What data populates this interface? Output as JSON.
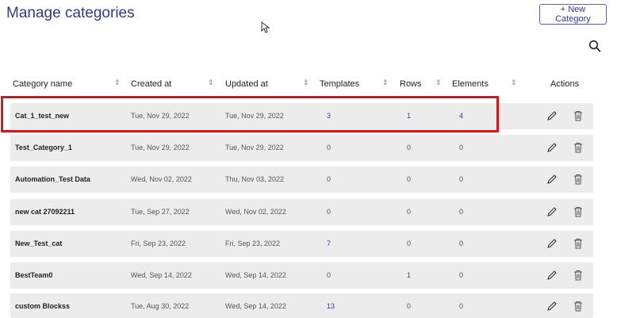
{
  "page": {
    "title": "Manage categories",
    "new_button": "+ New Category"
  },
  "table": {
    "headers": [
      "Category name",
      "Created at",
      "Updated at",
      "Templates",
      "Rows",
      "Elements",
      "Actions"
    ],
    "rows": [
      {
        "name": "Cat_1_test_new",
        "created": "Tue, Nov 29, 2022",
        "updated": "Tue, Nov 29, 2022",
        "templates": "3",
        "rows": "1",
        "elements": "4"
      },
      {
        "name": "Test_Category_1",
        "created": "Tue, Nov 29, 2022",
        "updated": "Tue, Nov 29, 2022",
        "templates": "0",
        "rows": "0",
        "elements": "0"
      },
      {
        "name": "Automation_Test Data",
        "created": "Wed, Nov 02, 2022",
        "updated": "Thu, Nov 03, 2022",
        "templates": "0",
        "rows": "0",
        "elements": "0"
      },
      {
        "name": "new cat 27092211",
        "created": "Tue, Sep 27, 2022",
        "updated": "Wed, Nov 02, 2022",
        "templates": "0",
        "rows": "0",
        "elements": "0"
      },
      {
        "name": "New_Test_cat",
        "created": "Fri, Sep 23, 2022",
        "updated": "Fri, Sep 23, 2022",
        "templates": "7",
        "rows": "0",
        "elements": "0"
      },
      {
        "name": "BestTeam0",
        "created": "Wed, Sep 14, 2022",
        "updated": "Wed, Sep 14, 2022",
        "templates": "0",
        "rows": "1",
        "elements": "0"
      },
      {
        "name": "custom Blockss",
        "created": "Tue, Aug 30, 2022",
        "updated": "Wed, Sep 14, 2022",
        "templates": "13",
        "rows": "0",
        "elements": "0"
      }
    ]
  },
  "icons": {
    "search": "search-icon",
    "edit": "pencil-icon",
    "delete": "trash-icon",
    "sort": "sort-icon",
    "cursor": "mouse-cursor-icon"
  },
  "colors": {
    "title": "#2f3a93",
    "link": "#3540a0",
    "row_bg": "#ececec",
    "highlight": "#d0171e"
  }
}
